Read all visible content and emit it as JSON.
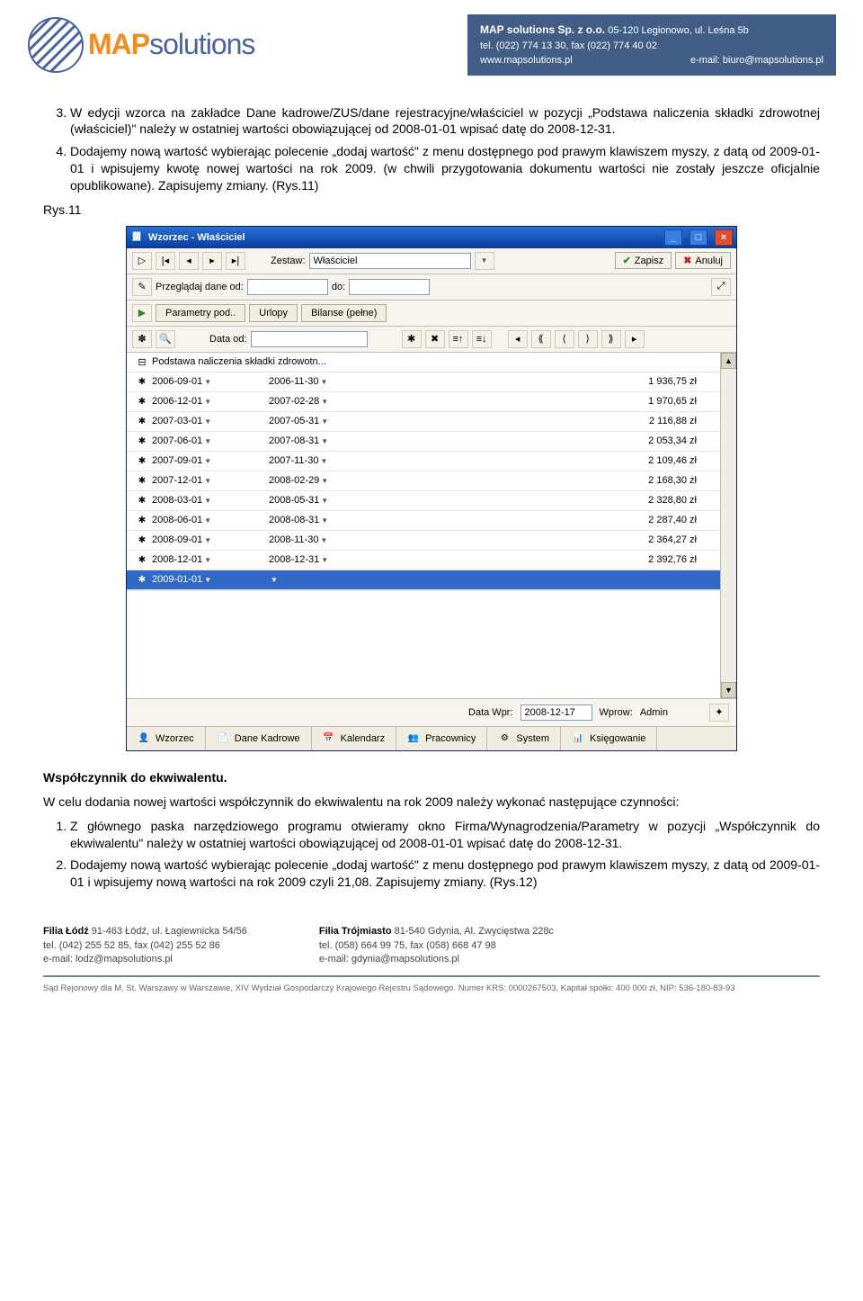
{
  "header": {
    "logo_pre": "MAP",
    "logo_post": "solutions",
    "company_name": "MAP solutions Sp. z o.o.",
    "company_addr": "05-120 Legionowo, ul. Leśna 5b",
    "company_tel": "tel. (022) 774 13 30, fax (022) 774 40 02",
    "company_web": "www.mapsolutions.pl",
    "company_email": "e-mail: biuro@mapsolutions.pl"
  },
  "doc": {
    "p3": "W edycji wzorca na zakładce Dane kadrowe/ZUS/dane rejestracyjne/właściciel w pozycji „Podstawa naliczenia składki zdrowotnej (właściciel)\" należy w ostatniej wartości obowiązującej od 2008-01-01 wpisać datę do 2008-12-31.",
    "p4": "Dodajemy nową wartość wybierając polecenie „dodaj wartość\" z menu dostępnego pod prawym klawiszem myszy, z datą od 2009-01-01 i wpisujemy kwotę nowej wartości na rok 2009. (w chwili przygotowania dokumentu wartości nie zostały jeszcze oficjalnie opublikowane). Zapisujemy zmiany. (Rys.11)",
    "caption": "Rys.11",
    "heading": "Współczynnik do ekwiwalentu.",
    "p_below": "W celu dodania nowej wartości współczynnik do ekwiwalentu na rok 2009 należy wykonać następujące czynności:",
    "li1": "Z głównego paska narzędziowego programu otwieramy okno Firma/Wynagrodzenia/Parametry w pozycji „Współczynnik do ekwiwalentu\" należy w ostatniej wartości obowiązującej od 2008-01-01 wpisać datę do 2008-12-31.",
    "li2": "Dodajemy nową wartość wybierając polecenie „dodaj wartość\" z menu dostępnego pod prawym klawiszem myszy, z datą od 2009-01-01 i wpisujemy nową wartości na rok 2009 czyli 21,08. Zapisujemy zmiany. (Rys.12)"
  },
  "app": {
    "title": "Wzorzec - Właściciel",
    "zestaw_label": "Zestaw:",
    "zestaw_value": "Właściciel",
    "zapisz": "Zapisz",
    "anuluj": "Anuluj",
    "przegladaj": "Przeglądaj dane od:",
    "do_label": "do:",
    "tab1": "Parametry pod..",
    "tab2": "Urlopy",
    "tab3": "Bilanse (pełne)",
    "data_od_label": "Data od:",
    "root_label": "Podstawa naliczenia składki zdrowotn...",
    "rows": [
      {
        "d1": "2006-09-01",
        "d2": "2006-11-30",
        "val": "1 936,75 zł"
      },
      {
        "d1": "2006-12-01",
        "d2": "2007-02-28",
        "val": "1 970,65 zł"
      },
      {
        "d1": "2007-03-01",
        "d2": "2007-05-31",
        "val": "2 116,88 zł"
      },
      {
        "d1": "2007-06-01",
        "d2": "2007-08-31",
        "val": "2 053,34 zł"
      },
      {
        "d1": "2007-09-01",
        "d2": "2007-11-30",
        "val": "2 109,46 zł"
      },
      {
        "d1": "2007-12-01",
        "d2": "2008-02-29",
        "val": "2 168,30 zł"
      },
      {
        "d1": "2008-03-01",
        "d2": "2008-05-31",
        "val": "2 328,80 zł"
      },
      {
        "d1": "2008-06-01",
        "d2": "2008-08-31",
        "val": "2 287,40 zł"
      },
      {
        "d1": "2008-09-01",
        "d2": "2008-11-30",
        "val": "2 364,27 zł"
      },
      {
        "d1": "2008-12-01",
        "d2": "2008-12-31",
        "val": "2 392,76 zł"
      }
    ],
    "sel_row_d1": "2009-01-01",
    "status_wpr_label": "Data Wpr:",
    "status_wpr_val": "2008-12-17",
    "status_wprow_label": "Wprow:",
    "status_wprow_val": "Admin",
    "btab1": "Wzorzec",
    "btab2": "Dane Kadrowe",
    "btab3": "Kalendarz",
    "btab4": "Pracownicy",
    "btab5": "System",
    "btab6": "Księgowanie"
  },
  "footer": {
    "b1_name": "Filia Łódź",
    "b1_addr": "91-463 Łódź, ul. Łagiewnicka 54/56",
    "b1_tel": "tel. (042) 255 52 85, fax (042) 255 52 86",
    "b1_mail": "e-mail: lodz@mapsolutions.pl",
    "b2_name": "Filia Trójmiasto",
    "b2_addr": "81-540 Gdynia, Al. Zwycięstwa 228c",
    "b2_tel": "tel. (058) 664 99 75, fax (058) 668 47 98",
    "b2_mail": "e-mail: gdynia@mapsolutions.pl",
    "legal": "Sąd Rejonowy dla M. St. Warszawy w Warszawie, XIV Wydział Gospodarczy Krajowego Rejestru Sądowego. Numer KRS: 0000267503, Kapitał spółki: 400 000 zł, NIP: 536-180-83-93"
  }
}
